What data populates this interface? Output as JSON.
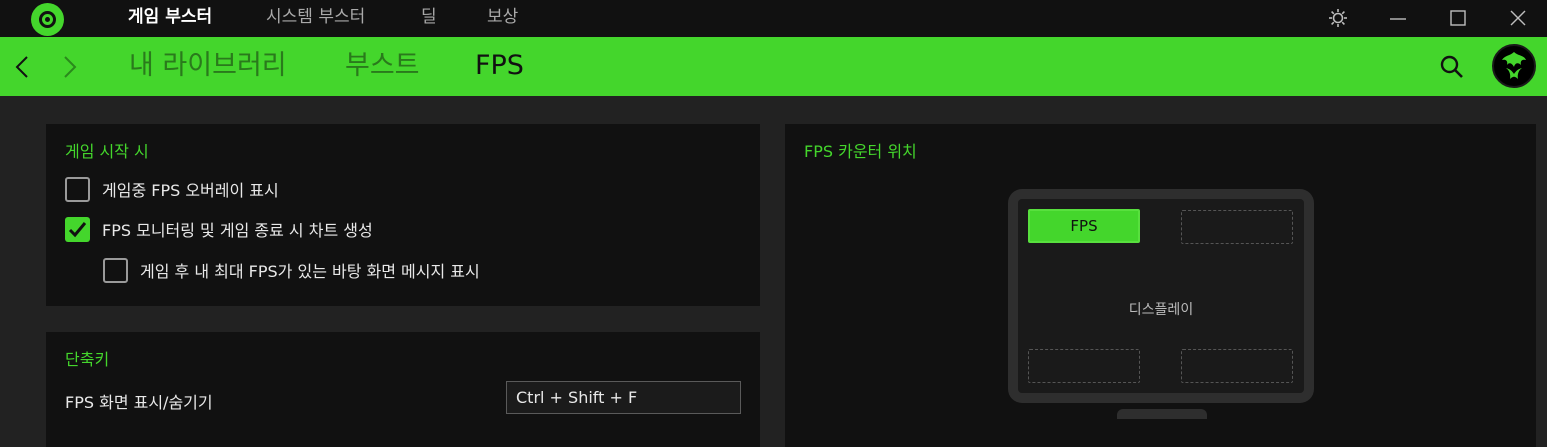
{
  "titlebar": {
    "tabs": [
      {
        "label": "게임 부스터",
        "active": true
      },
      {
        "label": "시스템 부스터",
        "active": false
      },
      {
        "label": "딜",
        "active": false
      },
      {
        "label": "보상",
        "active": false
      }
    ],
    "icons": [
      "settings-icon",
      "minimize-icon",
      "maximize-icon",
      "close-icon"
    ]
  },
  "navbar": {
    "tabs": [
      {
        "label": "내 라이브러리",
        "active": false
      },
      {
        "label": "부스트",
        "active": false
      },
      {
        "label": "FPS",
        "active": true
      }
    ],
    "accent_color": "#44d62c"
  },
  "game_start": {
    "title": "게임 시작 시",
    "options": [
      {
        "label": "게임중 FPS 오버레이 표시",
        "checked": false
      },
      {
        "label": "FPS 모니터링 및 게임 종료 시 차트 생성",
        "checked": true
      },
      {
        "label": "게임 후 내 최대 FPS가 있는 바탕 화면 메시지 표시",
        "checked": false
      }
    ]
  },
  "shortcuts": {
    "title": "단축키",
    "label": "FPS 화면 표시/숨기기",
    "value": "Ctrl + Shift + F"
  },
  "fps_position": {
    "title": "FPS 카운터 위치",
    "selected_slot_label": "FPS",
    "display_label": "디스플레이",
    "selected": "top-left"
  }
}
